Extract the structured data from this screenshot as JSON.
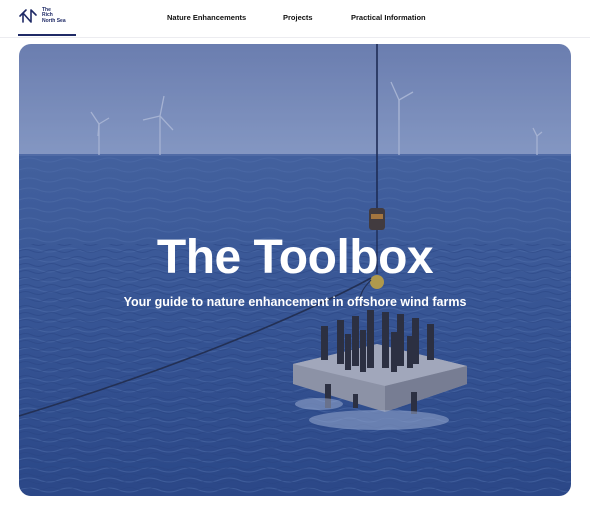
{
  "brand": {
    "logo_lines": [
      "The",
      "Rich",
      "North Sea"
    ]
  },
  "nav": {
    "items": [
      {
        "label": "Nature Enhancements"
      },
      {
        "label": "Projects"
      },
      {
        "label": "Practical Information"
      }
    ]
  },
  "hero": {
    "title": "The Toolbox",
    "subtitle": "Your guide to nature enhancement in offshore wind farms"
  },
  "colors": {
    "brand_navy": "#1f2a66",
    "sea": "#35548f",
    "sky": "#8fa2c9"
  }
}
